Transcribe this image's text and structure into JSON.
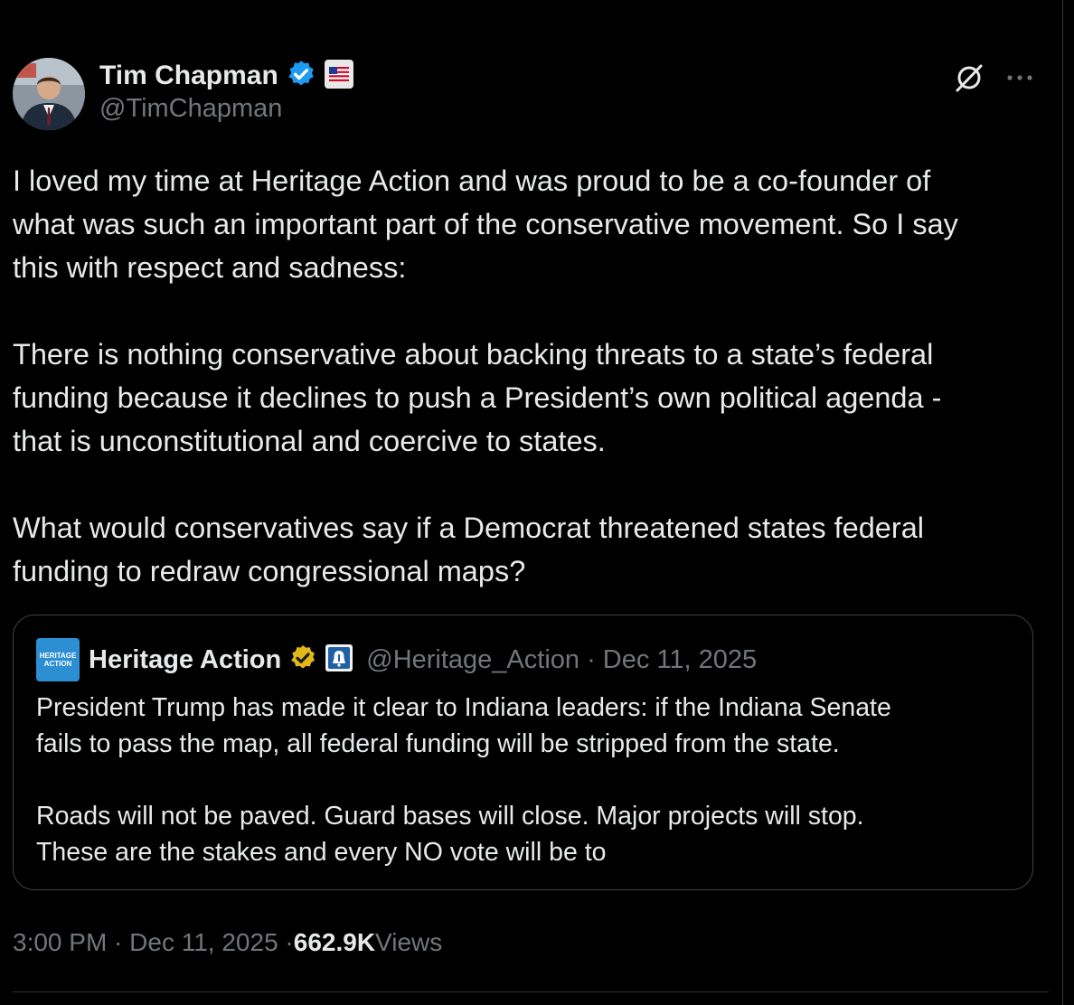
{
  "author": {
    "name": "Tim Chapman",
    "handle": "@TimChapman",
    "verified_color": "#1d9bf0",
    "badges": [
      "verified-badge-icon",
      "us-flag-icon"
    ]
  },
  "tweet": {
    "paragraphs": [
      [
        "I loved my time at Heritage Action and was proud to be a co-founder of",
        "what was such an important part of the conservative movement. So I say",
        "this with respect and sadness:"
      ],
      [
        "There is nothing conservative about backing threats to a state’s federal",
        "funding because it declines to push a President’s own political agenda -",
        "that is unconstitutional and coercive to states."
      ],
      [
        "What would conservatives say if a Democrat threatened states federal",
        "funding to redraw congressional maps?"
      ]
    ]
  },
  "quote": {
    "logo_lines": [
      "HERITAGE",
      "ACTION"
    ],
    "name": "Heritage Action",
    "handle_date": "@Heritage_Action · Dec 11, 2025",
    "verified_color": "#e2b719",
    "badges": [
      "gold-verified-badge-icon",
      "liberty-bell-icon"
    ],
    "paragraphs": [
      [
        "President Trump has made it clear to Indiana leaders: if the Indiana Senate",
        "fails to pass the map, all federal funding will be stripped from the state."
      ],
      [
        "Roads will not be paved. Guard bases will close. Major projects will stop.",
        "These are the stakes and every NO vote will be to"
      ]
    ]
  },
  "meta": {
    "time_date": "3:00 PM · Dec 11, 2025 · ",
    "views_count": "662.9K",
    "views_label": " Views"
  },
  "actions": {
    "grok_icon": "grok-icon",
    "more_icon": "more-dots-icon"
  },
  "colors": {
    "background": "#000000",
    "text": "#e7e9ea",
    "secondary": "#71767b",
    "border": "#2f3336"
  }
}
